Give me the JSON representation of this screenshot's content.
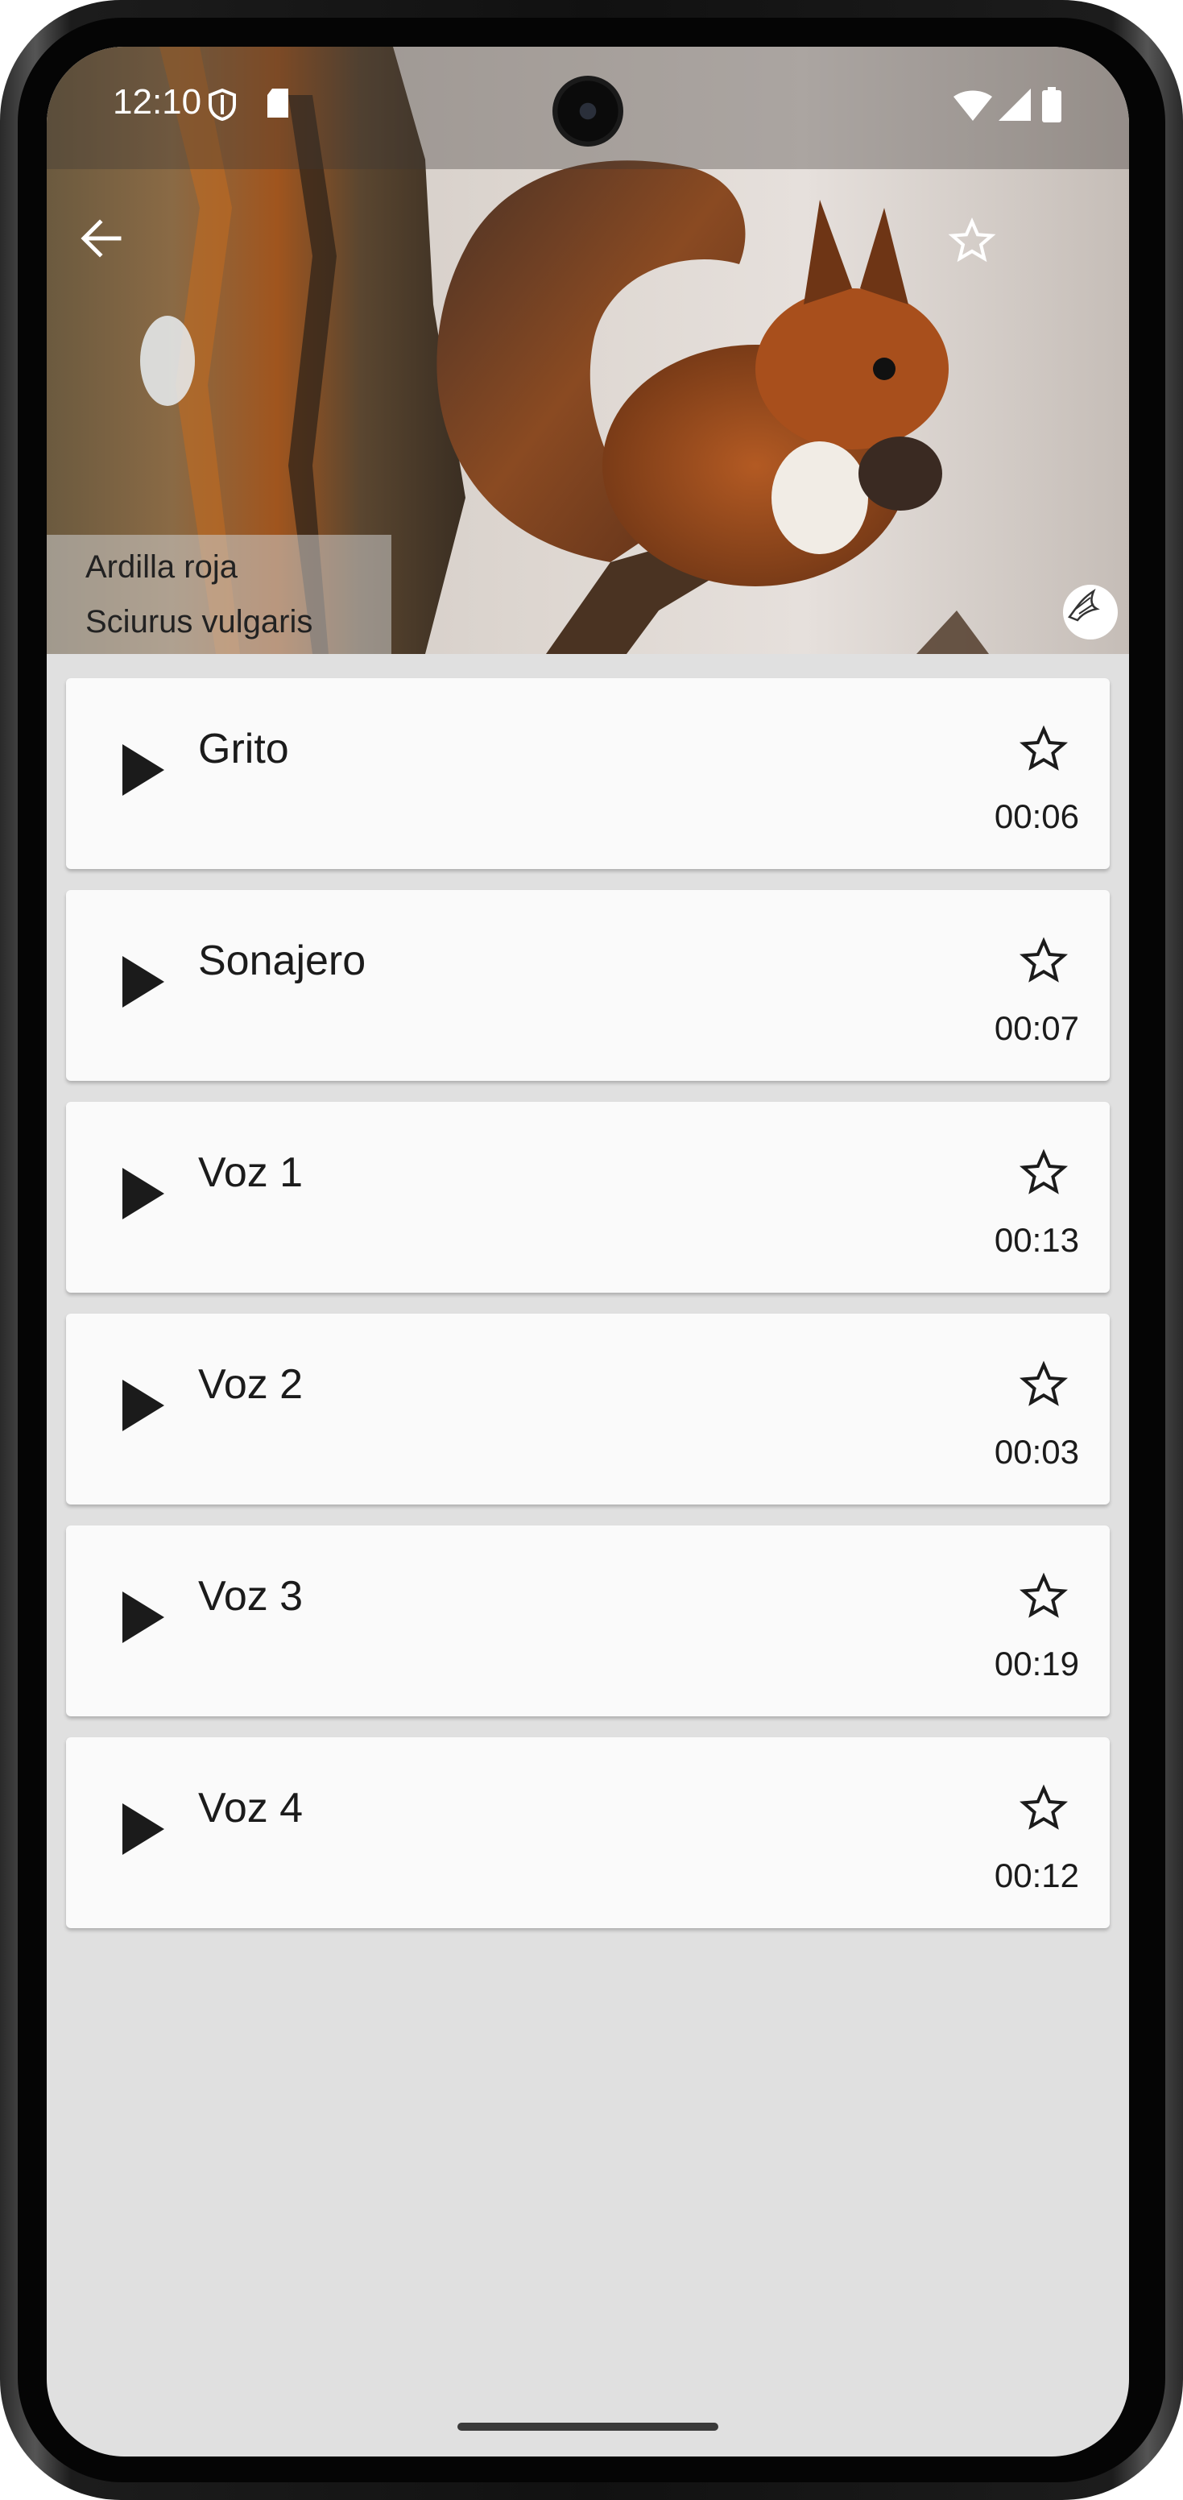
{
  "status_bar": {
    "time": "12:10",
    "icons": [
      "shield-icon",
      "sd-card-icon",
      "wifi-icon",
      "signal-icon",
      "battery-icon"
    ]
  },
  "header": {
    "back_icon": "arrow-left-icon",
    "favorite_icon": "star-outline-icon",
    "image": "red squirrel on branch",
    "common_name": "Ardilla roja",
    "scientific_name": "Sciurus vulgaris",
    "credit_icon": "bird-logo-icon"
  },
  "sounds": [
    {
      "title": "Grito",
      "duration": "00:06"
    },
    {
      "title": "Sonajero",
      "duration": "00:07"
    },
    {
      "title": "Voz 1",
      "duration": "00:13"
    },
    {
      "title": "Voz 2",
      "duration": "00:03"
    },
    {
      "title": "Voz 3",
      "duration": "00:19"
    },
    {
      "title": "Voz 4",
      "duration": "00:12"
    }
  ],
  "colors": {
    "background": "#e0e0e0",
    "card": "#fafafa",
    "text": "#1b1b1b"
  }
}
